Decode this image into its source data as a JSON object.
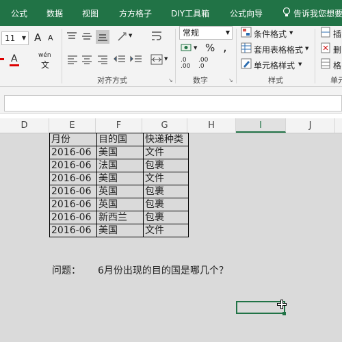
{
  "tabs": [
    "公式",
    "数据",
    "视图",
    "方方格子",
    "DIY工具箱",
    "公式向导",
    "告诉我您想要"
  ],
  "ribbon": {
    "font_size": "11",
    "number_format": "常规",
    "group_alignment": "对齐方式",
    "group_number": "数字",
    "group_styles": "样式",
    "group_cells": "单元",
    "conditional_format": "条件格式",
    "table_format": "套用表格格式",
    "cell_styles": "单元格样式",
    "insert": "插",
    "delete": "删",
    "format": "格",
    "percent": "%",
    "comma": ",",
    "inc_decimal": ".0\n.00",
    "dec_decimal": ".00\n.0",
    "font_grow": "A",
    "font_shrink": "A",
    "font_color": "A",
    "wen": "wén"
  },
  "columns": [
    "D",
    "E",
    "F",
    "G",
    "H",
    "I",
    "J"
  ],
  "active_column": "I",
  "table": {
    "header": [
      "月份",
      "目的国",
      "快递种类"
    ],
    "rows": [
      [
        "2016-06",
        "美国",
        "文件"
      ],
      [
        "2016-06",
        "法国",
        "包裹"
      ],
      [
        "2016-06",
        "美国",
        "文件"
      ],
      [
        "2016-06",
        "英国",
        "包裹"
      ],
      [
        "2016-06",
        "英国",
        "包裹"
      ],
      [
        "2016-06",
        "新西兰",
        "包裹"
      ],
      [
        "2016-06",
        "美国",
        "文件"
      ]
    ]
  },
  "question_label": "问题：",
  "question_text": "6月份出现的目的国是哪几个？",
  "colors": {
    "brand": "#217346",
    "selection": "#217346"
  }
}
